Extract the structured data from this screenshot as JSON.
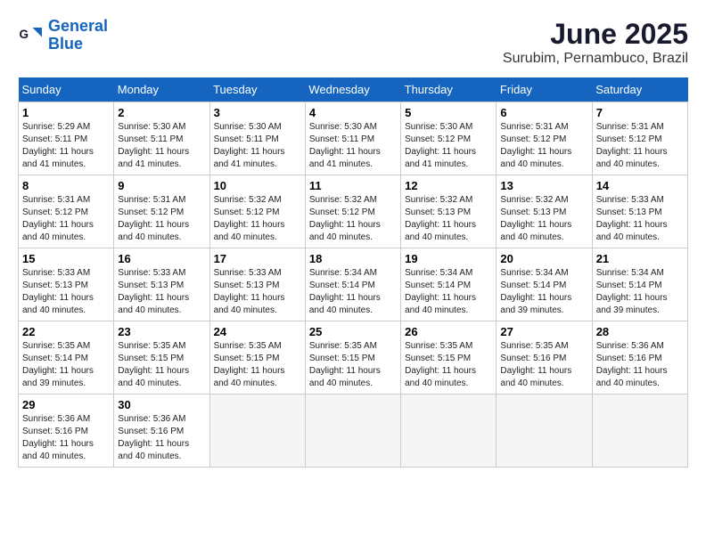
{
  "logo": {
    "line1": "General",
    "line2": "Blue"
  },
  "title": "June 2025",
  "location": "Surubim, Pernambuco, Brazil",
  "days_of_week": [
    "Sunday",
    "Monday",
    "Tuesday",
    "Wednesday",
    "Thursday",
    "Friday",
    "Saturday"
  ],
  "weeks": [
    [
      {
        "day": 1,
        "sunrise": "5:29 AM",
        "sunset": "5:11 PM",
        "daylight": "11 hours and 41 minutes."
      },
      {
        "day": 2,
        "sunrise": "5:30 AM",
        "sunset": "5:11 PM",
        "daylight": "11 hours and 41 minutes."
      },
      {
        "day": 3,
        "sunrise": "5:30 AM",
        "sunset": "5:11 PM",
        "daylight": "11 hours and 41 minutes."
      },
      {
        "day": 4,
        "sunrise": "5:30 AM",
        "sunset": "5:11 PM",
        "daylight": "11 hours and 41 minutes."
      },
      {
        "day": 5,
        "sunrise": "5:30 AM",
        "sunset": "5:12 PM",
        "daylight": "11 hours and 41 minutes."
      },
      {
        "day": 6,
        "sunrise": "5:31 AM",
        "sunset": "5:12 PM",
        "daylight": "11 hours and 40 minutes."
      },
      {
        "day": 7,
        "sunrise": "5:31 AM",
        "sunset": "5:12 PM",
        "daylight": "11 hours and 40 minutes."
      }
    ],
    [
      {
        "day": 8,
        "sunrise": "5:31 AM",
        "sunset": "5:12 PM",
        "daylight": "11 hours and 40 minutes."
      },
      {
        "day": 9,
        "sunrise": "5:31 AM",
        "sunset": "5:12 PM",
        "daylight": "11 hours and 40 minutes."
      },
      {
        "day": 10,
        "sunrise": "5:32 AM",
        "sunset": "5:12 PM",
        "daylight": "11 hours and 40 minutes."
      },
      {
        "day": 11,
        "sunrise": "5:32 AM",
        "sunset": "5:12 PM",
        "daylight": "11 hours and 40 minutes."
      },
      {
        "day": 12,
        "sunrise": "5:32 AM",
        "sunset": "5:13 PM",
        "daylight": "11 hours and 40 minutes."
      },
      {
        "day": 13,
        "sunrise": "5:32 AM",
        "sunset": "5:13 PM",
        "daylight": "11 hours and 40 minutes."
      },
      {
        "day": 14,
        "sunrise": "5:33 AM",
        "sunset": "5:13 PM",
        "daylight": "11 hours and 40 minutes."
      }
    ],
    [
      {
        "day": 15,
        "sunrise": "5:33 AM",
        "sunset": "5:13 PM",
        "daylight": "11 hours and 40 minutes."
      },
      {
        "day": 16,
        "sunrise": "5:33 AM",
        "sunset": "5:13 PM",
        "daylight": "11 hours and 40 minutes."
      },
      {
        "day": 17,
        "sunrise": "5:33 AM",
        "sunset": "5:13 PM",
        "daylight": "11 hours and 40 minutes."
      },
      {
        "day": 18,
        "sunrise": "5:34 AM",
        "sunset": "5:14 PM",
        "daylight": "11 hours and 40 minutes."
      },
      {
        "day": 19,
        "sunrise": "5:34 AM",
        "sunset": "5:14 PM",
        "daylight": "11 hours and 40 minutes."
      },
      {
        "day": 20,
        "sunrise": "5:34 AM",
        "sunset": "5:14 PM",
        "daylight": "11 hours and 39 minutes."
      },
      {
        "day": 21,
        "sunrise": "5:34 AM",
        "sunset": "5:14 PM",
        "daylight": "11 hours and 39 minutes."
      }
    ],
    [
      {
        "day": 22,
        "sunrise": "5:35 AM",
        "sunset": "5:14 PM",
        "daylight": "11 hours and 39 minutes."
      },
      {
        "day": 23,
        "sunrise": "5:35 AM",
        "sunset": "5:15 PM",
        "daylight": "11 hours and 40 minutes."
      },
      {
        "day": 24,
        "sunrise": "5:35 AM",
        "sunset": "5:15 PM",
        "daylight": "11 hours and 40 minutes."
      },
      {
        "day": 25,
        "sunrise": "5:35 AM",
        "sunset": "5:15 PM",
        "daylight": "11 hours and 40 minutes."
      },
      {
        "day": 26,
        "sunrise": "5:35 AM",
        "sunset": "5:15 PM",
        "daylight": "11 hours and 40 minutes."
      },
      {
        "day": 27,
        "sunrise": "5:35 AM",
        "sunset": "5:16 PM",
        "daylight": "11 hours and 40 minutes."
      },
      {
        "day": 28,
        "sunrise": "5:36 AM",
        "sunset": "5:16 PM",
        "daylight": "11 hours and 40 minutes."
      }
    ],
    [
      {
        "day": 29,
        "sunrise": "5:36 AM",
        "sunset": "5:16 PM",
        "daylight": "11 hours and 40 minutes."
      },
      {
        "day": 30,
        "sunrise": "5:36 AM",
        "sunset": "5:16 PM",
        "daylight": "11 hours and 40 minutes."
      },
      null,
      null,
      null,
      null,
      null
    ]
  ]
}
